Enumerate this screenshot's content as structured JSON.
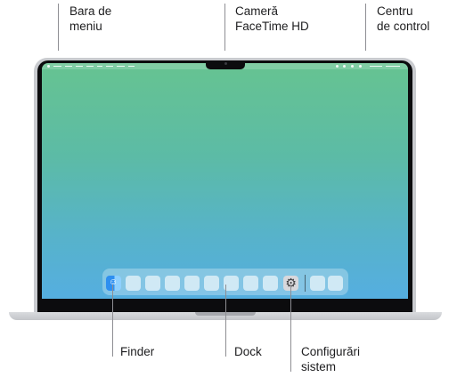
{
  "callouts": {
    "menu_bar": "Bara de\nmeniu",
    "camera": "Cameră\nFaceTime HD",
    "control_center": "Centru\nde control",
    "finder": "Finder",
    "dock": "Dock",
    "system_settings": "Configurări\nsistem"
  },
  "icons": {
    "finder": "finder-icon",
    "system_settings": "gear-icon"
  },
  "colors": {
    "wallpaper_top": "#66c391",
    "wallpaper_bottom": "#55aee0",
    "bezel": "#0c0c0e",
    "aluminum": "#c9cbcf"
  }
}
